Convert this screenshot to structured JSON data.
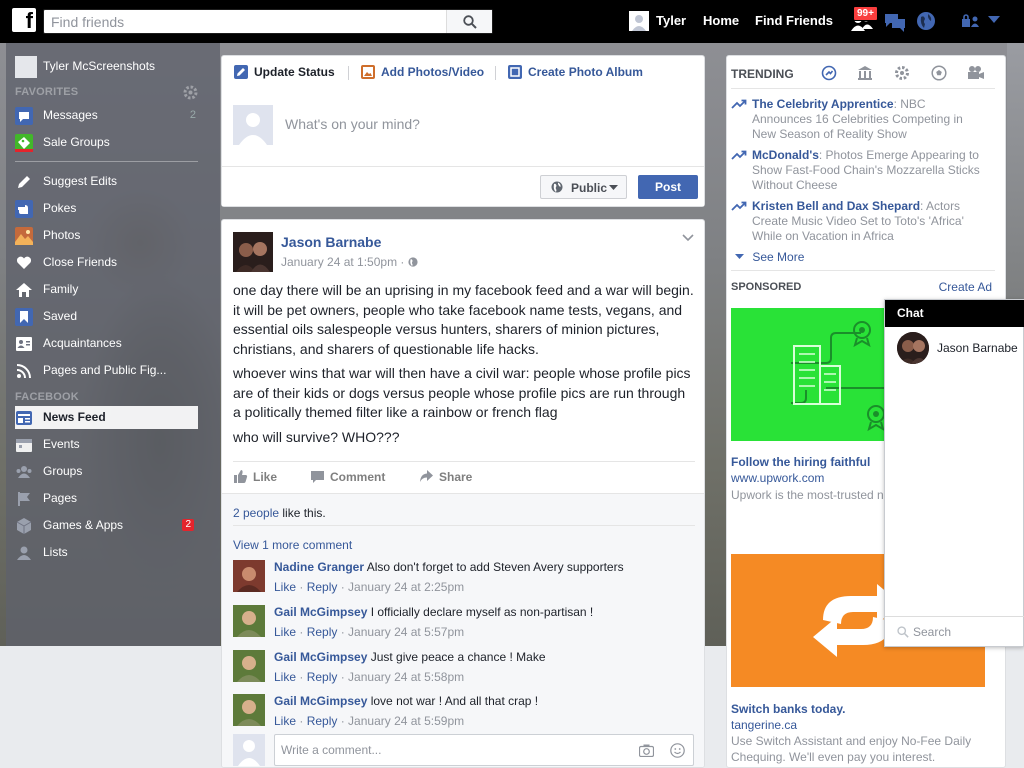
{
  "topbar": {
    "logo_letter": "f",
    "search_placeholder": "Find friends",
    "user_name": "Tyler",
    "home_label": "Home",
    "find_friends_label": "Find Friends",
    "friend_requests_badge": "99+"
  },
  "sidebar": {
    "profile_name": "Tyler McScreenshots",
    "favorites_header": "FAVORITES",
    "facebook_header": "FACEBOOK",
    "favorites": [
      {
        "label": "Messages",
        "count": "2",
        "icon": "messages-icon"
      },
      {
        "label": "Sale Groups",
        "count": "",
        "icon": "sale-groups-icon"
      }
    ],
    "shortcuts": [
      {
        "label": "Suggest Edits",
        "icon": "pencil-icon"
      },
      {
        "label": "Pokes",
        "icon": "poke-icon"
      },
      {
        "label": "Photos",
        "icon": "photos-icon"
      },
      {
        "label": "Close Friends",
        "icon": "heart-icon"
      },
      {
        "label": "Family",
        "icon": "house-icon"
      },
      {
        "label": "Saved",
        "icon": "bookmark-icon"
      },
      {
        "label": "Acquaintances",
        "icon": "acquaintances-icon"
      },
      {
        "label": "Pages and Public Fig...",
        "icon": "rss-icon"
      }
    ],
    "facebook_items": [
      {
        "label": "News Feed",
        "selected": true,
        "icon": "news-feed-icon"
      },
      {
        "label": "Events",
        "icon": "events-icon"
      },
      {
        "label": "Groups",
        "icon": "groups-icon"
      },
      {
        "label": "Pages",
        "icon": "pages-icon"
      },
      {
        "label": "Games & Apps",
        "badge": "2",
        "icon": "games-icon"
      },
      {
        "label": "Lists",
        "icon": "lists-icon"
      }
    ]
  },
  "composer": {
    "tab_status": "Update Status",
    "tab_photos": "Add Photos/Video",
    "tab_album": "Create Photo Album",
    "placeholder": "What's on your mind?",
    "privacy": "Public",
    "post_button": "Post"
  },
  "post": {
    "author": "Jason Barnabe",
    "time": "January 24 at 1:50pm",
    "paragraphs": [
      "one day there will be an uprising in my facebook feed and a war will begin. it will be pet owners, people who take facebook name tests, vegans, and essential oils salespeople versus hunters, sharers of minion pictures, christians, and sharers of questionable life hacks.",
      "whoever wins that war will then have a civil war: people whose profile pics are of their kids or dogs versus people whose profile pics are run through a politically themed filter like a rainbow or french flag",
      "who will survive? WHO???"
    ],
    "like_label": "Like",
    "comment_label": "Comment",
    "share_label": "Share",
    "likes_link": "2 people",
    "likes_suffix": " like this.",
    "more_comments": "View 1 more comment",
    "comments": [
      {
        "name": "Nadine Granger",
        "text": "Also don't forget to add Steven Avery supporters",
        "time": "January 24 at 2:25pm"
      },
      {
        "name": "Gail McGimpsey",
        "text": "I officially declare myself as non-partisan !",
        "time": "January 24 at 5:57pm"
      },
      {
        "name": "Gail McGimpsey",
        "text": "Just give peace a chance ! Make",
        "time": "January 24 at 5:58pm"
      },
      {
        "name": "Gail McGimpsey",
        "text": "love not war ! And all that crap !",
        "time": "January 24 at 5:59pm"
      }
    ],
    "comment_like": "Like",
    "comment_reply": "Reply",
    "write_placeholder": "Write a comment..."
  },
  "trending": {
    "header": "TRENDING",
    "items": [
      {
        "title": "The Celebrity Apprentice",
        "desc": ": NBC Announces 16 Celebrities Competing in New Season of Reality Show"
      },
      {
        "title": "McDonald's",
        "desc": ": Photos Emerge Appearing to Show Fast-Food Chain's Mozzarella Sticks Without Cheese"
      },
      {
        "title": "Kristen Bell and Dax Shepard",
        "desc": ": Actors Create Music Video Set to Toto's 'Africa' While on Vacation in Africa"
      }
    ],
    "see_more": "See More"
  },
  "sponsored": {
    "header": "SPONSORED",
    "create_ad": "Create Ad",
    "ads": [
      {
        "title": "Follow the hiring faithful",
        "url": "www.upwork.com",
        "desc": "Upwork is the most-trusted n talent, bar none.",
        "color": "#29e237"
      },
      {
        "title": "Switch banks today.",
        "url": "tangerine.ca",
        "desc": "Use Switch Assistant and enjoy No-Fee Daily Chequing. We'll even pay you interest.",
        "color": "#f58a24"
      }
    ]
  },
  "chat": {
    "header": "Chat",
    "contact": "Jason Barnabe",
    "search_placeholder": "Search"
  },
  "colors": {
    "topbar": "#000000",
    "link": "#365899",
    "post_button": "#4267b2",
    "badge": "#fa3e3e"
  }
}
